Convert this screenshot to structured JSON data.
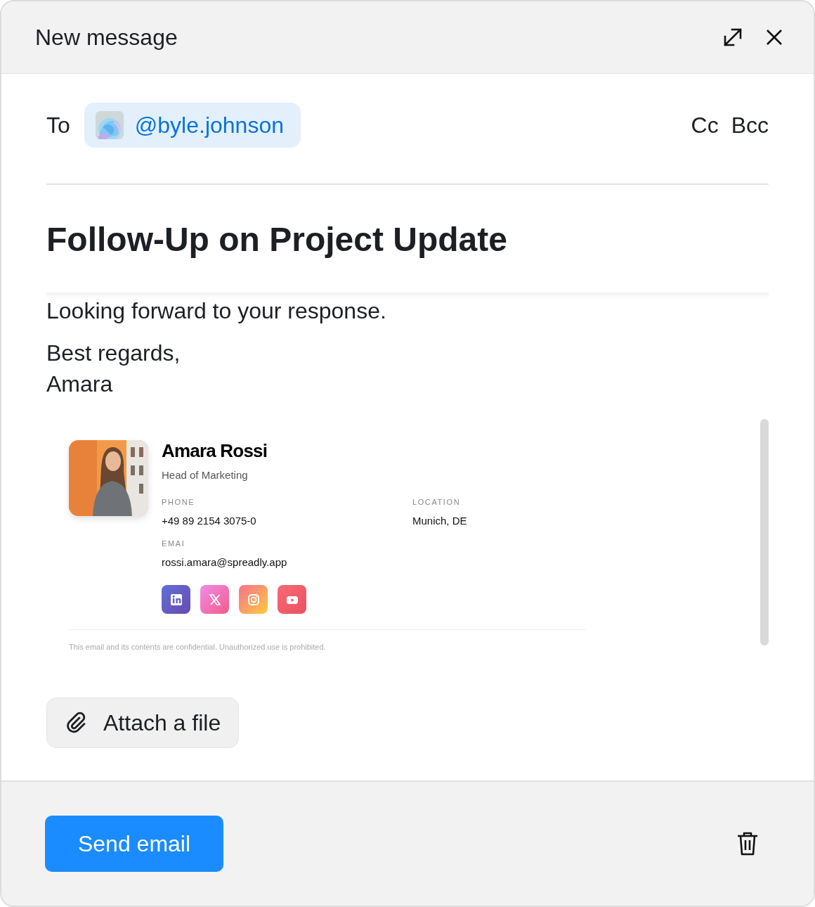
{
  "window": {
    "title": "New message"
  },
  "recipients": {
    "label": "To",
    "chips": [
      {
        "handle": "@byle.johnson"
      }
    ],
    "cc": "Cc",
    "bcc": "Bcc"
  },
  "subject": "Follow-Up on Project Update",
  "body": {
    "paragraphs": [
      [
        "Looking forward to your response."
      ],
      [
        "Best regards,",
        "Amara"
      ]
    ]
  },
  "signature": {
    "name": "Amara Rossi",
    "role": "Head of Marketing",
    "fields": [
      {
        "label": "PHONE",
        "value": "+49 89 2154 3075-0"
      },
      {
        "label": "LOCATION",
        "value": "Munich, DE"
      },
      {
        "label": "EMAI",
        "value": "rossi.amara@spreadly.app"
      }
    ],
    "socials": [
      {
        "kind": "linkedin"
      },
      {
        "kind": "x"
      },
      {
        "kind": "instagram"
      },
      {
        "kind": "youtube"
      }
    ],
    "disclaimer": "This email and its contents are confidential. Unauthorized use is prohibited."
  },
  "attach": {
    "label": "Attach a file"
  },
  "send": {
    "label": "Send email"
  }
}
